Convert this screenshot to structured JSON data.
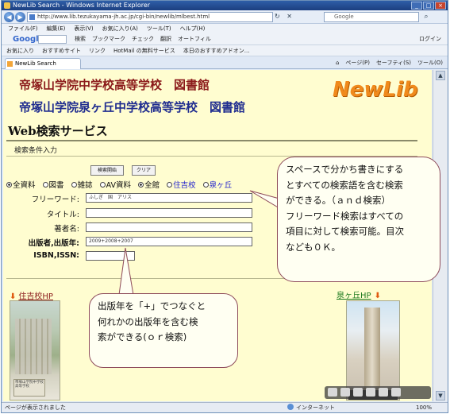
{
  "browser": {
    "window_title": "NewLib Search - Windows Internet Explorer",
    "url": "http://www.lib.tezukayama-jh.ac.jp/cgi-bin/newlib/mlbest.html",
    "search_placeholder": "Google",
    "menu": [
      "ファイル(F)",
      "編集(E)",
      "表示(V)",
      "お気に入り(A)",
      "ツール(T)",
      "ヘルプ(H)"
    ],
    "google_bar": {
      "logo": "Google",
      "items": [
        "検索",
        "ブックマーク",
        "チェック",
        "翻訳",
        "オートフィル"
      ],
      "right": "ログイン"
    },
    "favorites": [
      "お気に入り",
      "おすすめサイト",
      "リンク",
      "HotMail の無料サービス",
      "本日のおすすめアドオン..."
    ],
    "tab_label": "NewLib Search",
    "tab_tools": [
      "ページ(P)",
      "セーフティ(S)",
      "ツール(O)"
    ],
    "status_left": "ページが表示されました",
    "status_zone": "インターネット",
    "zoom": "100%"
  },
  "page": {
    "school1": "帝塚山学院中学校高等学校　図書館",
    "school2": "帝塚山学院泉ヶ丘中学校高等学校　図書館",
    "logo": "NewLib",
    "title": "Web検索サービス",
    "subtitle": "検索条件入力",
    "search_button": "検索開始",
    "clear_button": "クリア",
    "material_types": [
      "全資料",
      "図書",
      "雑誌",
      "AV資料"
    ],
    "locations": [
      "全館",
      "住吉校",
      "泉ヶ丘"
    ],
    "fields": [
      {
        "label": "フリーワード:",
        "value": "ふしぎ　国　アリス"
      },
      {
        "label": "タイトル:",
        "value": ""
      },
      {
        "label": "著者名:",
        "value": ""
      },
      {
        "label": "出版者,出版年:",
        "value": "2009+2008+2007"
      },
      {
        "label": "ISBN,ISSN:",
        "value": ""
      }
    ],
    "hp_left": "住吉校HP",
    "hp_right": "泉ヶ丘HP",
    "photo1_sign": "帝塚山学院中学校高等学校"
  },
  "callouts": {
    "c1": [
      "スペースで分かち書きにする",
      "とすべての検索語を含む検索",
      "ができる。（ａｎｄ検索）",
      "フリーワード検索はすべての",
      "項目に対して検索可能。目次",
      "なども０Ｋ。"
    ],
    "c2": [
      "出版年を「+」でつなぐと",
      "何れかの出版年を含む検",
      "索ができる(ｏｒ検索)"
    ]
  }
}
